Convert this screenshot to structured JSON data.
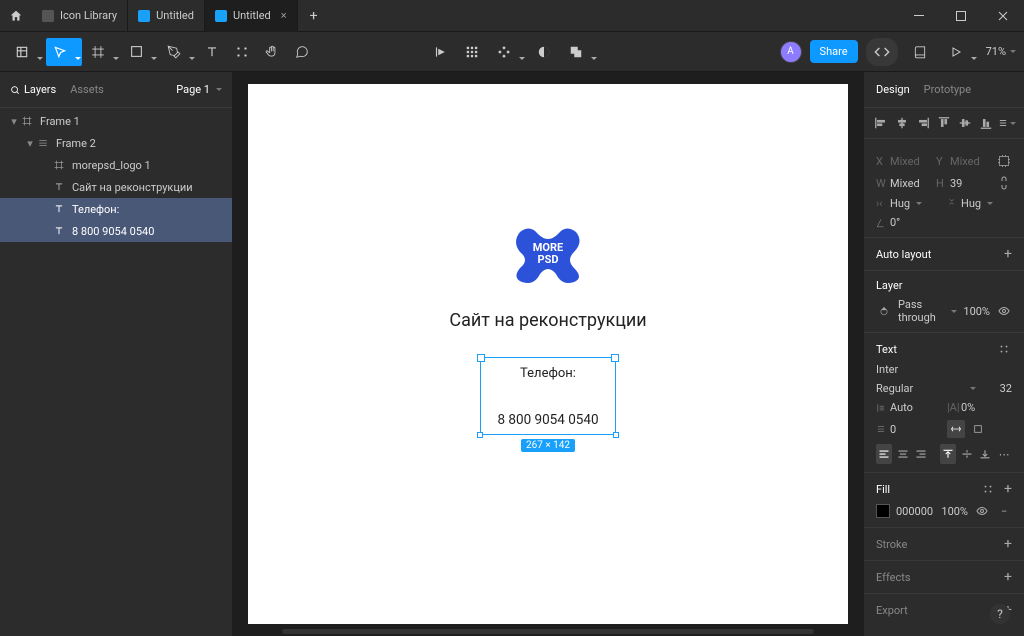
{
  "tabs": [
    {
      "label": "Icon Library",
      "active": false,
      "iconGray": true
    },
    {
      "label": "Untitled",
      "active": false,
      "iconGray": false
    },
    {
      "label": "Untitled",
      "active": true,
      "iconGray": false
    }
  ],
  "toolbar": {
    "avatar_initial": "A",
    "share_label": "Share",
    "zoom": "71%"
  },
  "left_panel": {
    "layers_tab": "Layers",
    "assets_tab": "Assets",
    "page_label": "Page 1",
    "tree": [
      {
        "label": "Frame 1",
        "indent": 0,
        "icon": "frame",
        "selected": false,
        "expanded": true
      },
      {
        "label": "Frame 2",
        "indent": 1,
        "icon": "frame-small",
        "selected": false,
        "expanded": true
      },
      {
        "label": "morepsd_logo 1",
        "indent": 2,
        "icon": "frame",
        "selected": false
      },
      {
        "label": "Сайт на реконструкции",
        "indent": 2,
        "icon": "text",
        "selected": false
      },
      {
        "label": "Телефон:",
        "indent": 2,
        "icon": "text",
        "selected": true
      },
      {
        "label": "8 800 9054 0540",
        "indent": 2,
        "icon": "text",
        "selected": true
      }
    ]
  },
  "canvas": {
    "logo_line1": "MORE",
    "logo_line2": "PSD",
    "title": "Сайт на реконструкции",
    "selected_text1": "Телефон:",
    "selected_text2": "8 800 9054 0540",
    "dimensions_badge": "267 × 142"
  },
  "right_panel": {
    "tabs": {
      "design": "Design",
      "prototype": "Prototype"
    },
    "position": {
      "x_label": "X",
      "x_value": "Mixed",
      "y_label": "Y",
      "y_value": "Mixed",
      "w_label": "W",
      "w_value": "Mixed",
      "h_label": "H",
      "h_value": "39",
      "hug_h": "Hug",
      "hug_v": "Hug",
      "rotation_label": "0°"
    },
    "auto_layout": "Auto layout",
    "layer": {
      "title": "Layer",
      "blend": "Pass through",
      "opacity": "100%"
    },
    "text": {
      "title": "Text",
      "font": "Inter",
      "weight": "Regular",
      "size": "32",
      "line_auto": "Auto",
      "letter_spacing": "0%",
      "para": "0"
    },
    "fill": {
      "title": "Fill",
      "hex": "000000",
      "opacity": "100%"
    },
    "stroke": "Stroke",
    "effects": "Effects",
    "export": "Export"
  }
}
